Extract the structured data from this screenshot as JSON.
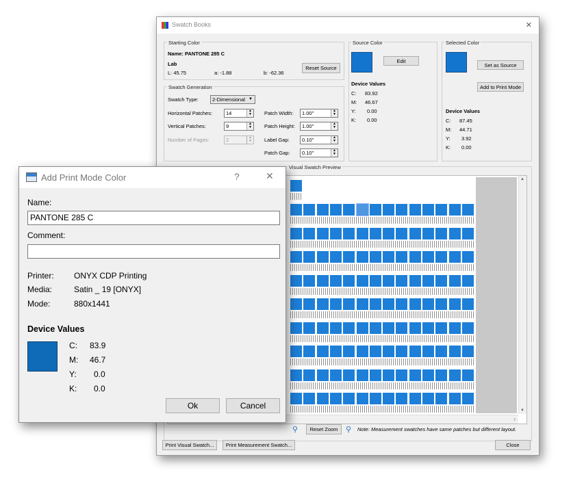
{
  "swatch_books": {
    "title": "Swatch Books",
    "close_glyph": "✕",
    "starting_color": {
      "group_title": "Starting Color",
      "name_line": "Name: PANTONE 285 C",
      "space": "Lab",
      "L": "L: 45.75",
      "a": "a: -1.88",
      "b": "b: -62.36",
      "reset_button": "Reset Source"
    },
    "swatch_generation": {
      "group_title": "Swatch Generation",
      "swatch_type_label": "Swatch Type:",
      "swatch_type_value": "2-Dimensional",
      "horizontal_label": "Horizontal Patches:",
      "horizontal_value": "14",
      "vertical_label": "Vertical Patches:",
      "vertical_value": "9",
      "pages_label": "Number of Pages:",
      "pages_value": "2",
      "patch_width_label": "Patch Width:",
      "patch_width_value": "1.00\"",
      "patch_height_label": "Patch Height:",
      "patch_height_value": "1.00\"",
      "label_gap_label": "Label Gap:",
      "label_gap_value": "0.10\"",
      "patch_gap_label": "Patch Gap:",
      "patch_gap_value": "0.10\""
    },
    "source_color": {
      "group_title": "Source Color",
      "edit_button": "Edit",
      "device_values_title": "Device Values",
      "values": [
        {
          "channel": "C:",
          "value": "83.92"
        },
        {
          "channel": "M:",
          "value": "46.67"
        },
        {
          "channel": "Y:",
          "value": "0.00"
        },
        {
          "channel": "K:",
          "value": "0.00"
        }
      ]
    },
    "selected_color": {
      "group_title": "Selected Color",
      "set_source_button": "Set as Source",
      "add_print_mode_button": "Add to Print Mode",
      "device_values_title": "Device Values",
      "values": [
        {
          "channel": "C:",
          "value": "87.45"
        },
        {
          "channel": "M:",
          "value": "44.71"
        },
        {
          "channel": "Y:",
          "value": "3.92"
        },
        {
          "channel": "K:",
          "value": "0.00"
        }
      ]
    },
    "preview": {
      "group_title": "Visual Swatch Preview"
    },
    "reset_zoom_button": "Reset Zoom",
    "note": "Note: Measurement swatches have same patches but different layout.",
    "print_visual_button": "Print Visual Swatch...",
    "print_measurement_button": "Print Measurement Swatch...",
    "close_button": "Close"
  },
  "dialog": {
    "title": "Add Print Mode Color",
    "help_glyph": "?",
    "close_glyph": "✕",
    "name_label": "Name:",
    "name_value": "PANTONE 285 C",
    "comment_label": "Comment:",
    "comment_value": "",
    "printer_label": "Printer:",
    "printer_value": "ONYX CDP Printing",
    "media_label": "Media:",
    "media_value": "Satin _ 19 [ONYX]",
    "mode_label": "Mode:",
    "mode_value": "880x1441",
    "device_values_title": "Device Values",
    "values": [
      {
        "channel": "C:",
        "value": "83.9"
      },
      {
        "channel": "M:",
        "value": "46.7"
      },
      {
        "channel": "Y:",
        "value": "0.0"
      },
      {
        "channel": "K:",
        "value": "0.0"
      }
    ],
    "ok_button": "Ok",
    "cancel_button": "Cancel"
  },
  "colors": {
    "source_swatch": "#1475cf",
    "selected_swatch": "#1475cf",
    "dialog_swatch": "#0f6bb8",
    "patch": "#1d7fd8"
  }
}
